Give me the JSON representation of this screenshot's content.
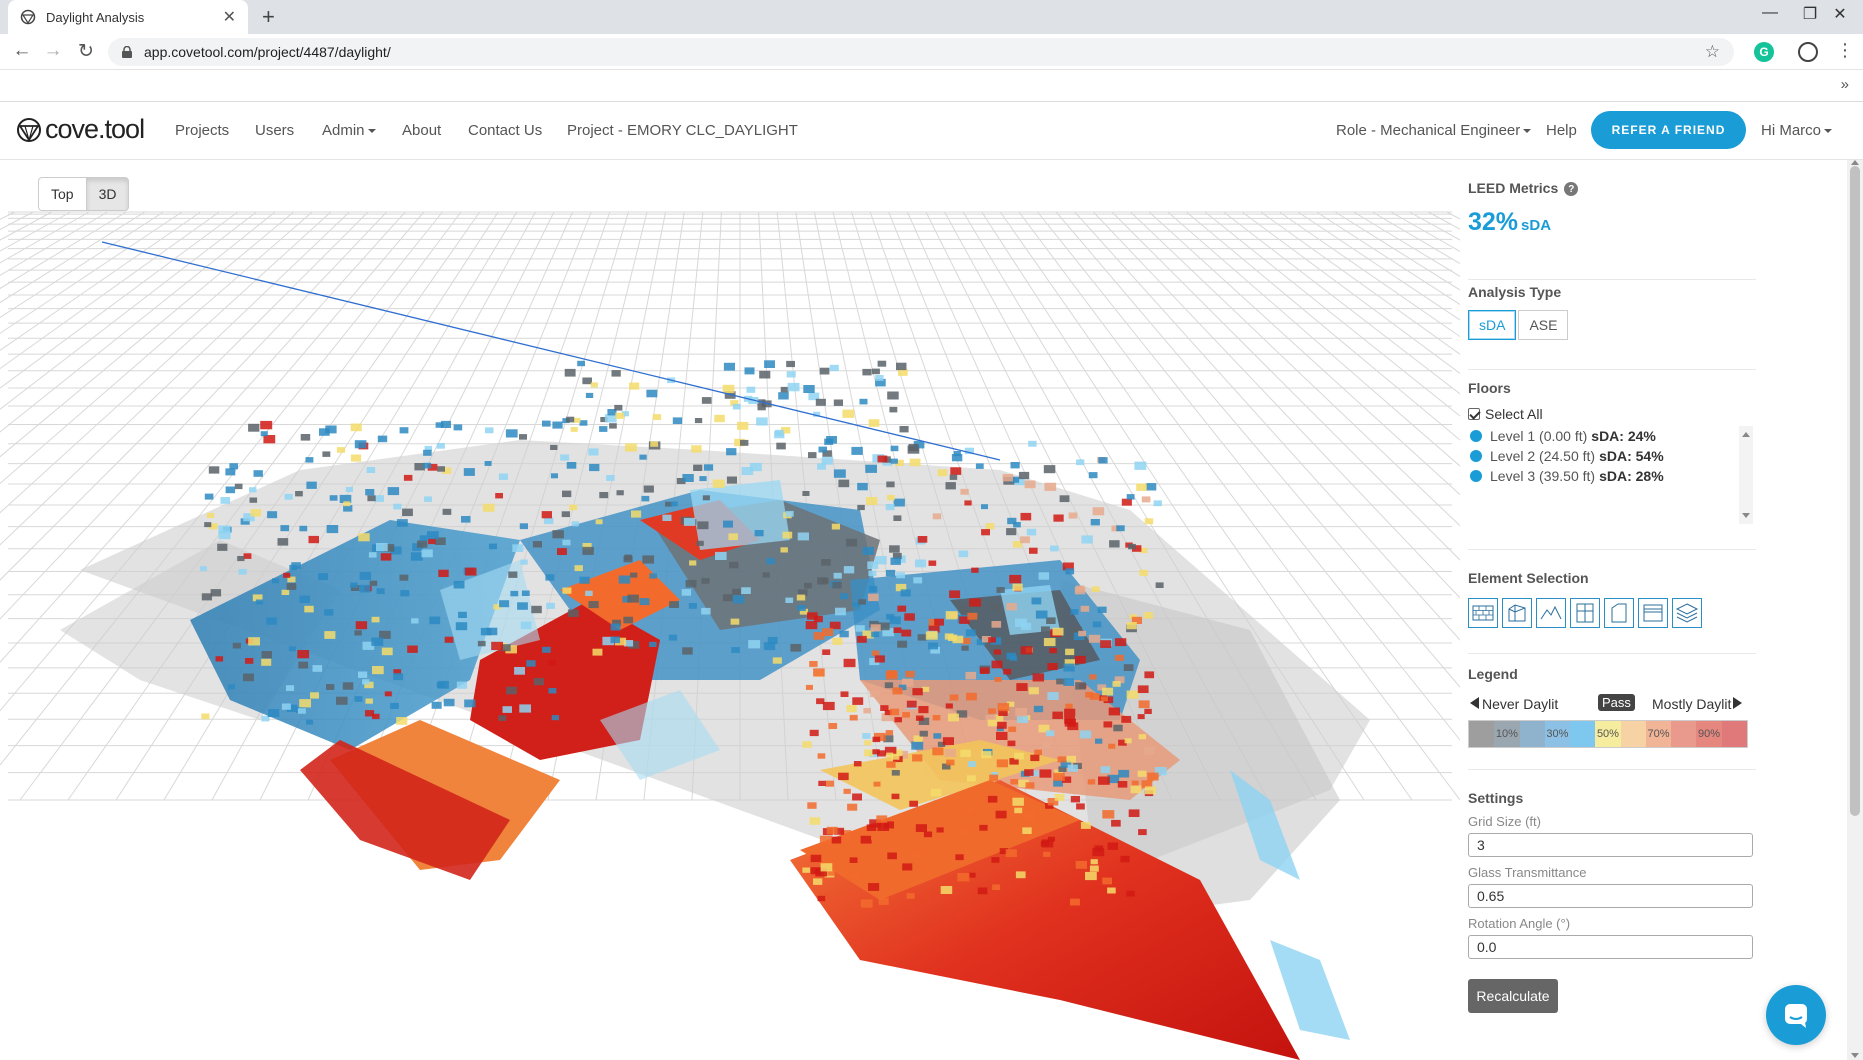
{
  "browser": {
    "tab_title": "Daylight Analysis",
    "url": "app.covetool.com/project/4487/daylight/",
    "extension_g": "G"
  },
  "nav": {
    "logo_text": "cove.tool",
    "links": [
      "Projects",
      "Users",
      "Admin",
      "About",
      "Contact Us",
      "Project - EMORY CLC_DAYLIGHT"
    ],
    "role": "Role - Mechanical Engineer",
    "help": "Help",
    "refer": "REFER A FRIEND",
    "user": "Hi Marco"
  },
  "view": {
    "options": [
      "Top",
      "3D"
    ],
    "active": "3D"
  },
  "panel": {
    "leed": {
      "title": "LEED Metrics",
      "value": "32%",
      "unit": "sDA"
    },
    "analysis_type": {
      "title": "Analysis Type",
      "options": [
        "sDA",
        "ASE"
      ],
      "active": "sDA"
    },
    "floors": {
      "title": "Floors",
      "select_all": "Select All",
      "select_all_checked": true,
      "items": [
        {
          "label": "Level 1 (0.00 ft)",
          "sda": "sDA: 24%"
        },
        {
          "label": "Level 2 (24.50 ft)",
          "sda": "sDA: 54%"
        },
        {
          "label": "Level 3 (39.50 ft)",
          "sda": "sDA: 28%"
        }
      ],
      "dot_color": "#1a9cd6"
    },
    "element_selection": {
      "title": "Element Selection",
      "icons": [
        "wall-icon",
        "mass-icon",
        "roof-icon",
        "window-icon",
        "door-icon",
        "shade-icon",
        "layers-icon"
      ]
    },
    "legend": {
      "title": "Legend",
      "left": "Never Daylit",
      "pass": "Pass",
      "right": "Mostly Daylit",
      "cells": [
        {
          "label": "",
          "color": "#9e9e9e"
        },
        {
          "label": "10%",
          "color": "#9ba7b0"
        },
        {
          "label": "",
          "color": "#8fb3cc"
        },
        {
          "label": "30%",
          "color": "#8cc0e4"
        },
        {
          "label": "",
          "color": "#7ec8ef"
        },
        {
          "label": "50%",
          "color": "#f6ec9e"
        },
        {
          "label": "",
          "color": "#f6d2a5"
        },
        {
          "label": "70%",
          "color": "#f1b497"
        },
        {
          "label": "",
          "color": "#ea9a8c"
        },
        {
          "label": "90%",
          "color": "#e5877e"
        },
        {
          "label": "",
          "color": "#e07a7a"
        }
      ]
    },
    "settings": {
      "title": "Settings",
      "grid_size_label": "Grid Size (ft)",
      "grid_size": "3",
      "glass_label": "Glass Transmittance",
      "glass": "0.65",
      "rotation_label": "Rotation Angle (°)",
      "rotation": "0.0",
      "recalculate": "Recalculate"
    }
  },
  "colors": {
    "accent": "#1a9cd6",
    "heat_red": "#d11a14",
    "heat_orange": "#f26b2d",
    "heat_yellow": "#f5dc6b",
    "heat_blue": "#2d8ac2",
    "glass_blue": "#8fd3f2",
    "massing_gray": "#b9b9b9"
  }
}
